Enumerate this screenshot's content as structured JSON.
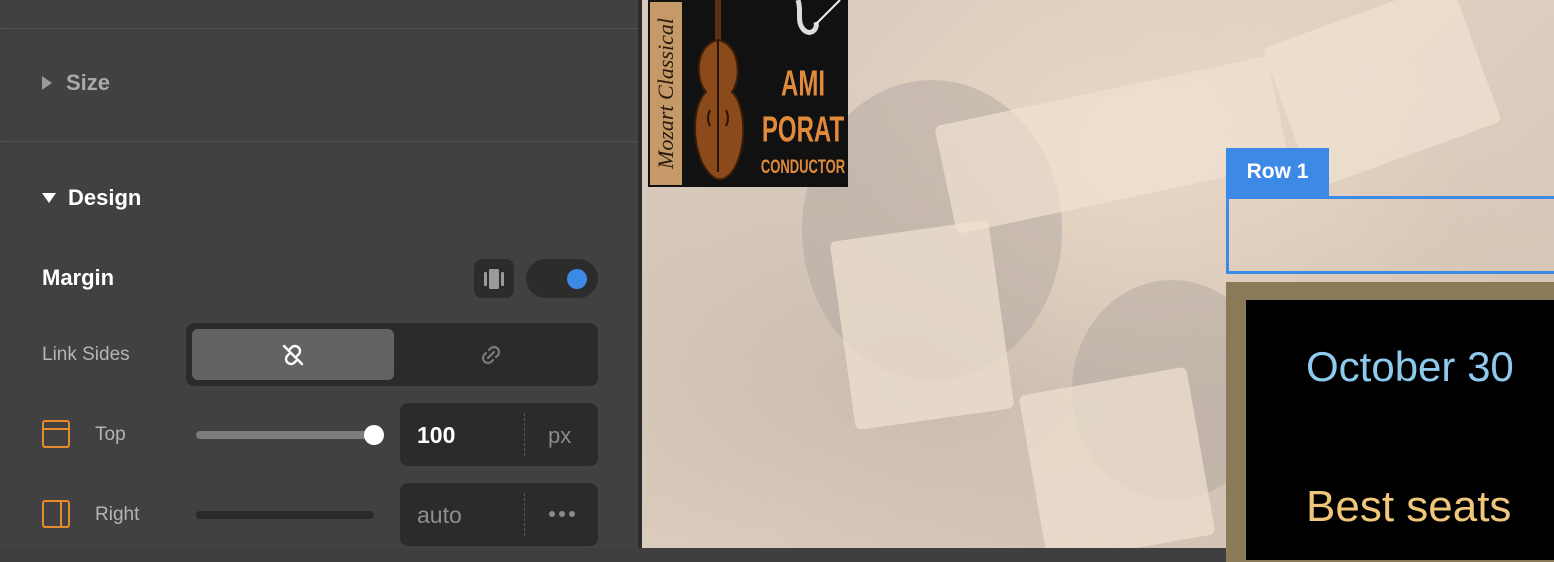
{
  "panel": {
    "sections": {
      "size": {
        "label": "Size",
        "expanded": false
      },
      "design": {
        "label": "Design",
        "expanded": true
      }
    },
    "margin": {
      "label": "Margin",
      "responsive_toggle_on": true,
      "link_sides": {
        "label": "Link Sides",
        "options": [
          "unlinked-icon",
          "linked-icon"
        ],
        "selected": "unlinked-icon"
      },
      "top": {
        "label": "Top",
        "value": "100",
        "unit": "px",
        "slider_fraction": 1.0
      },
      "right": {
        "label": "Right",
        "value": "auto",
        "unit_icon": "more-dots-icon",
        "slider_fraction": 0.0
      }
    }
  },
  "canvas": {
    "row_tag": "Row 1",
    "event_date": "October 30",
    "tagline": "Best seats",
    "poster": {
      "side_text": "Mozart Classical",
      "line1": "AMI",
      "line2": "PORAT",
      "line3": "CONDUCTOR"
    }
  },
  "colors": {
    "accent": "#3d8ae6",
    "side_icon": "#e58b2e",
    "date_text": "#8ec9ee",
    "tagline_text": "#f0c67a"
  }
}
